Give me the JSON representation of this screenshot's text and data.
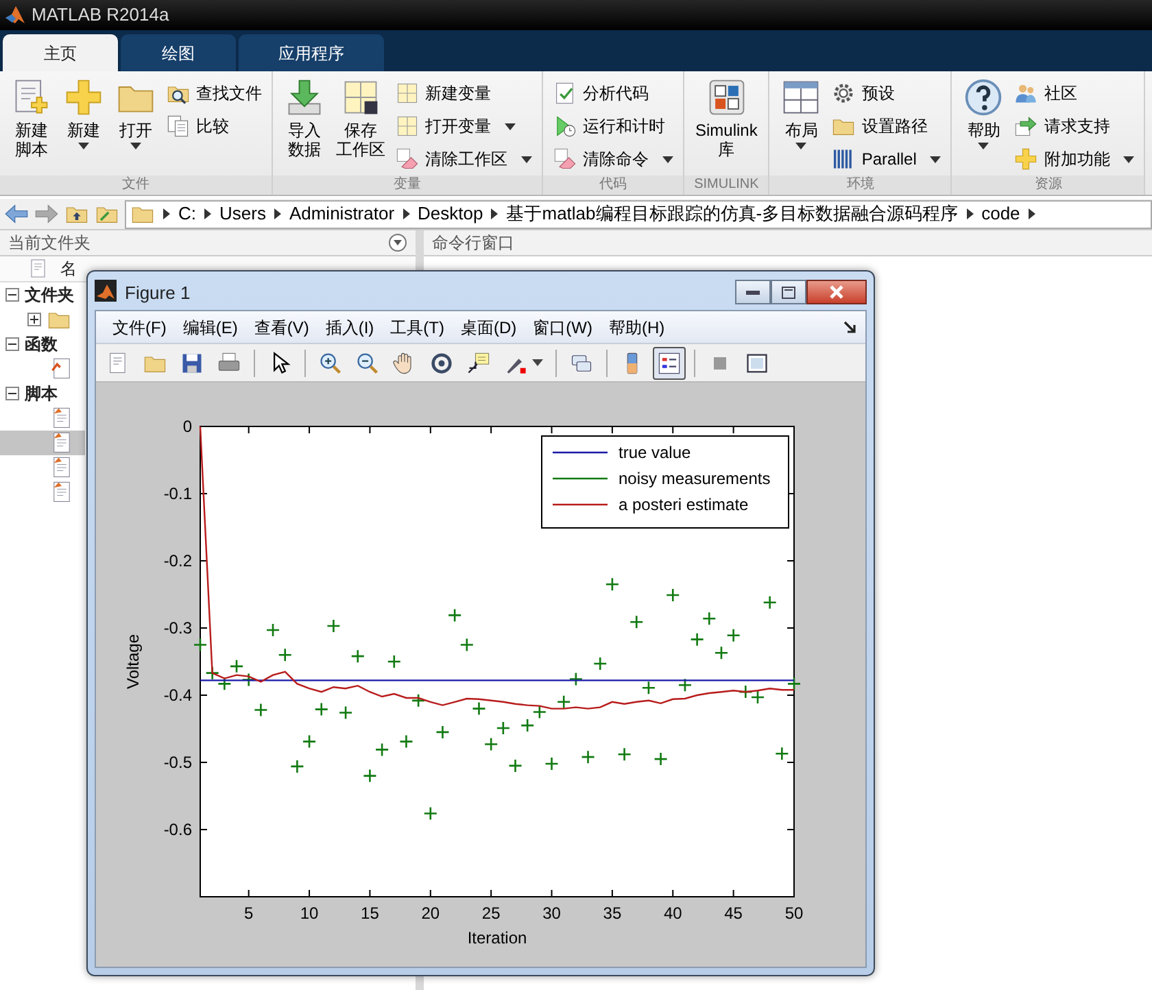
{
  "window": {
    "title": "MATLAB R2014a"
  },
  "tabs": [
    {
      "label": "主页",
      "selected": true
    },
    {
      "label": "绘图",
      "selected": false
    },
    {
      "label": "应用程序",
      "selected": false
    }
  ],
  "ribbon": [
    {
      "label": "文件",
      "items": [
        {
          "kind": "large",
          "lines": [
            "新建",
            "脚本"
          ],
          "dropdown": false
        },
        {
          "kind": "large",
          "lines": [
            "新建"
          ],
          "dropdown": true
        },
        {
          "kind": "large",
          "lines": [
            "打开"
          ],
          "dropdown": true
        },
        {
          "kind": "stack",
          "items": [
            {
              "label": "查找文件",
              "dropdown": false
            },
            {
              "label": "比较",
              "dropdown": false
            }
          ]
        }
      ]
    },
    {
      "label": "变量",
      "items": [
        {
          "kind": "large",
          "lines": [
            "导入",
            "数据"
          ],
          "dropdown": false
        },
        {
          "kind": "large",
          "lines": [
            "保存",
            "工作区"
          ],
          "dropdown": false
        },
        {
          "kind": "stack",
          "items": [
            {
              "label": "新建变量",
              "dropdown": false
            },
            {
              "label": "打开变量",
              "dropdown": true
            },
            {
              "label": "清除工作区",
              "dropdown": true
            }
          ]
        }
      ]
    },
    {
      "label": "代码",
      "items": [
        {
          "kind": "stack",
          "items": [
            {
              "label": "分析代码",
              "dropdown": false
            },
            {
              "label": "运行和计时",
              "dropdown": false
            },
            {
              "label": "清除命令",
              "dropdown": true
            }
          ]
        }
      ]
    },
    {
      "label": "SIMULINK",
      "items": [
        {
          "kind": "large",
          "lines": [
            "Simulink",
            "库"
          ],
          "dropdown": false
        }
      ]
    },
    {
      "label": "环境",
      "items": [
        {
          "kind": "large",
          "lines": [
            "布局"
          ],
          "dropdown": true
        },
        {
          "kind": "stack",
          "items": [
            {
              "label": "预设",
              "dropdown": false
            },
            {
              "label": "设置路径",
              "dropdown": false
            },
            {
              "label": "Parallel",
              "dropdown": true
            }
          ]
        }
      ]
    },
    {
      "label": "资源",
      "items": [
        {
          "kind": "large",
          "lines": [
            "帮助"
          ],
          "dropdown": true
        },
        {
          "kind": "stack",
          "items": [
            {
              "label": "社区",
              "dropdown": false
            },
            {
              "label": "请求支持",
              "dropdown": false
            },
            {
              "label": "附加功能",
              "dropdown": true
            }
          ]
        }
      ]
    }
  ],
  "address": {
    "segments": [
      "C:",
      "Users",
      "Administrator",
      "Desktop",
      "基于matlab编程目标跟踪的仿真-多目标数据融合源码程序",
      "code"
    ]
  },
  "file_panel": {
    "title": "当前文件夹",
    "column": "名",
    "tree": [
      {
        "label": "文件夹",
        "expanded": true,
        "children": [
          {
            "kind": "folder",
            "expanded": false,
            "selected": false
          }
        ]
      },
      {
        "label": "函数",
        "expanded": true,
        "children": [
          {
            "kind": "function",
            "selected": false
          }
        ]
      },
      {
        "label": "脚本",
        "expanded": true,
        "children": [
          {
            "kind": "script",
            "selected": false
          },
          {
            "kind": "script",
            "selected": true
          },
          {
            "kind": "script",
            "selected": false
          },
          {
            "kind": "script",
            "selected": false
          }
        ]
      }
    ]
  },
  "command_panel": {
    "title": "命令行窗口"
  },
  "figure": {
    "title": "Figure 1",
    "menus": [
      "文件(F)",
      "编辑(E)",
      "查看(V)",
      "插入(I)",
      "工具(T)",
      "桌面(D)",
      "窗口(W)",
      "帮助(H)"
    ],
    "toolbar": [
      {
        "kind": "new",
        "pressed": false
      },
      {
        "kind": "open",
        "pressed": false
      },
      {
        "kind": "save",
        "pressed": false
      },
      {
        "kind": "print",
        "pressed": false
      },
      {
        "kind": "separator"
      },
      {
        "kind": "pointer",
        "pressed": false
      },
      {
        "kind": "separator"
      },
      {
        "kind": "zoomin",
        "pressed": false
      },
      {
        "kind": "zoomout",
        "pressed": false
      },
      {
        "kind": "pan",
        "pressed": false
      },
      {
        "kind": "rotate",
        "pressed": false
      },
      {
        "kind": "datacursor",
        "pressed": false
      },
      {
        "kind": "brush",
        "pressed": false
      },
      {
        "kind": "separator"
      },
      {
        "kind": "link",
        "pressed": false
      },
      {
        "kind": "separator"
      },
      {
        "kind": "colorbar",
        "pressed": false
      },
      {
        "kind": "legend",
        "pressed": true
      },
      {
        "kind": "separator"
      },
      {
        "kind": "hidetools",
        "pressed": false
      },
      {
        "kind": "showtools",
        "pressed": false
      }
    ],
    "chart_data": {
      "type": "line",
      "legend": "upper right",
      "xlabel": "Iteration",
      "ylabel": "Voltage",
      "xlim": [
        1,
        50
      ],
      "ylim": [
        -0.7,
        0
      ],
      "xticks": [
        5,
        10,
        15,
        20,
        25,
        30,
        35,
        40,
        45,
        50
      ],
      "yticks": [
        0,
        -0.1,
        -0.2,
        -0.3,
        -0.4,
        -0.5,
        -0.6
      ],
      "x": [
        1,
        2,
        3,
        4,
        5,
        6,
        7,
        8,
        9,
        10,
        11,
        12,
        13,
        14,
        15,
        16,
        17,
        18,
        19,
        20,
        21,
        22,
        23,
        24,
        25,
        26,
        27,
        28,
        29,
        30,
        31,
        32,
        33,
        34,
        35,
        36,
        37,
        38,
        39,
        40,
        41,
        42,
        43,
        44,
        45,
        46,
        47,
        48,
        49,
        50
      ],
      "series": [
        {
          "name": "true value",
          "color": "#1a1aa8",
          "values": [
            -0.378,
            -0.378,
            -0.378,
            -0.378,
            -0.378,
            -0.378,
            -0.378,
            -0.378,
            -0.378,
            -0.378,
            -0.378,
            -0.378,
            -0.378,
            -0.378,
            -0.378,
            -0.378,
            -0.378,
            -0.378,
            -0.378,
            -0.378,
            -0.378,
            -0.378,
            -0.378,
            -0.378,
            -0.378,
            -0.378,
            -0.378,
            -0.378,
            -0.378,
            -0.378,
            -0.378,
            -0.378,
            -0.378,
            -0.378,
            -0.378,
            -0.378,
            -0.378,
            -0.378,
            -0.378,
            -0.378,
            -0.378,
            -0.378,
            -0.378,
            -0.378,
            -0.378,
            -0.378,
            -0.378,
            -0.378,
            -0.378,
            -0.378
          ]
        },
        {
          "name": "noisy measurements",
          "color": "#117a11",
          "type": "scatter",
          "marker": "+",
          "values": [
            -0.325,
            -0.367,
            -0.383,
            -0.357,
            -0.377,
            -0.422,
            -0.303,
            -0.34,
            -0.506,
            -0.469,
            -0.421,
            -0.297,
            -0.426,
            -0.342,
            -0.52,
            -0.481,
            -0.35,
            -0.469,
            -0.408,
            -0.576,
            -0.455,
            -0.281,
            -0.325,
            -0.42,
            -0.473,
            -0.449,
            -0.505,
            -0.445,
            -0.425,
            -0.502,
            -0.41,
            -0.376,
            -0.492,
            -0.353,
            -0.235,
            -0.488,
            -0.291,
            -0.389,
            -0.495,
            -0.251,
            -0.385,
            -0.317,
            -0.286,
            -0.337,
            -0.311,
            -0.395,
            -0.403,
            -0.262,
            -0.487,
            -0.383
          ]
        },
        {
          "name": "a posteri estimate",
          "color": "#b81c1c",
          "values": [
            0,
            -0.367,
            -0.375,
            -0.37,
            -0.372,
            -0.38,
            -0.37,
            -0.365,
            -0.383,
            -0.39,
            -0.395,
            -0.388,
            -0.39,
            -0.386,
            -0.395,
            -0.402,
            -0.398,
            -0.404,
            -0.404,
            -0.41,
            -0.415,
            -0.41,
            -0.405,
            -0.406,
            -0.408,
            -0.41,
            -0.413,
            -0.415,
            -0.416,
            -0.42,
            -0.42,
            -0.418,
            -0.42,
            -0.418,
            -0.41,
            -0.413,
            -0.41,
            -0.408,
            -0.412,
            -0.406,
            -0.405,
            -0.4,
            -0.397,
            -0.395,
            -0.393,
            -0.395,
            -0.393,
            -0.39,
            -0.392,
            -0.392
          ]
        }
      ]
    }
  }
}
